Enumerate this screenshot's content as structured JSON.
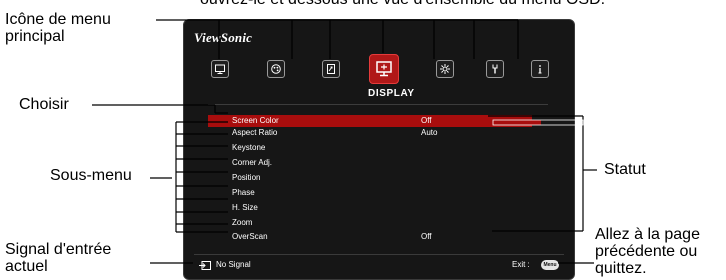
{
  "header_text": "ouvrez-le et dessous une vue d'ensemble du menu OSD.",
  "callouts": {
    "main_menu_icon": [
      "Icône de menu",
      "principal"
    ],
    "select": "Choisir",
    "submenu": "Sous-menu",
    "current_input_signal": [
      "Signal d'entrée",
      "actuel"
    ],
    "status": "Statut",
    "back_or_exit": [
      "Allez à la page",
      "précédente ou",
      "quittez."
    ]
  },
  "osd": {
    "brand": "ViewSonic",
    "menu_title": "DISPLAY",
    "icons": [
      "display-icon",
      "picture-icon",
      "source-icon",
      "display-active-icon",
      "settings-icon",
      "advanced-tools-icon",
      "information-icon"
    ],
    "items": [
      {
        "label": "Screen Color",
        "value": "Off"
      },
      {
        "label": "Aspect Ratio",
        "value": "Auto"
      },
      {
        "label": "Keystone",
        "value": ""
      },
      {
        "label": "Corner Adj.",
        "value": ""
      },
      {
        "label": "Position",
        "value": ""
      },
      {
        "label": "Phase",
        "value": ""
      },
      {
        "label": "H. Size",
        "value": ""
      },
      {
        "label": "Zoom",
        "value": ""
      },
      {
        "label": "OverScan",
        "value": "Off"
      }
    ],
    "signal": "No Signal",
    "exit_label": "Exit :",
    "menu_button": "Menu",
    "accent_color": "#a80d0d"
  }
}
